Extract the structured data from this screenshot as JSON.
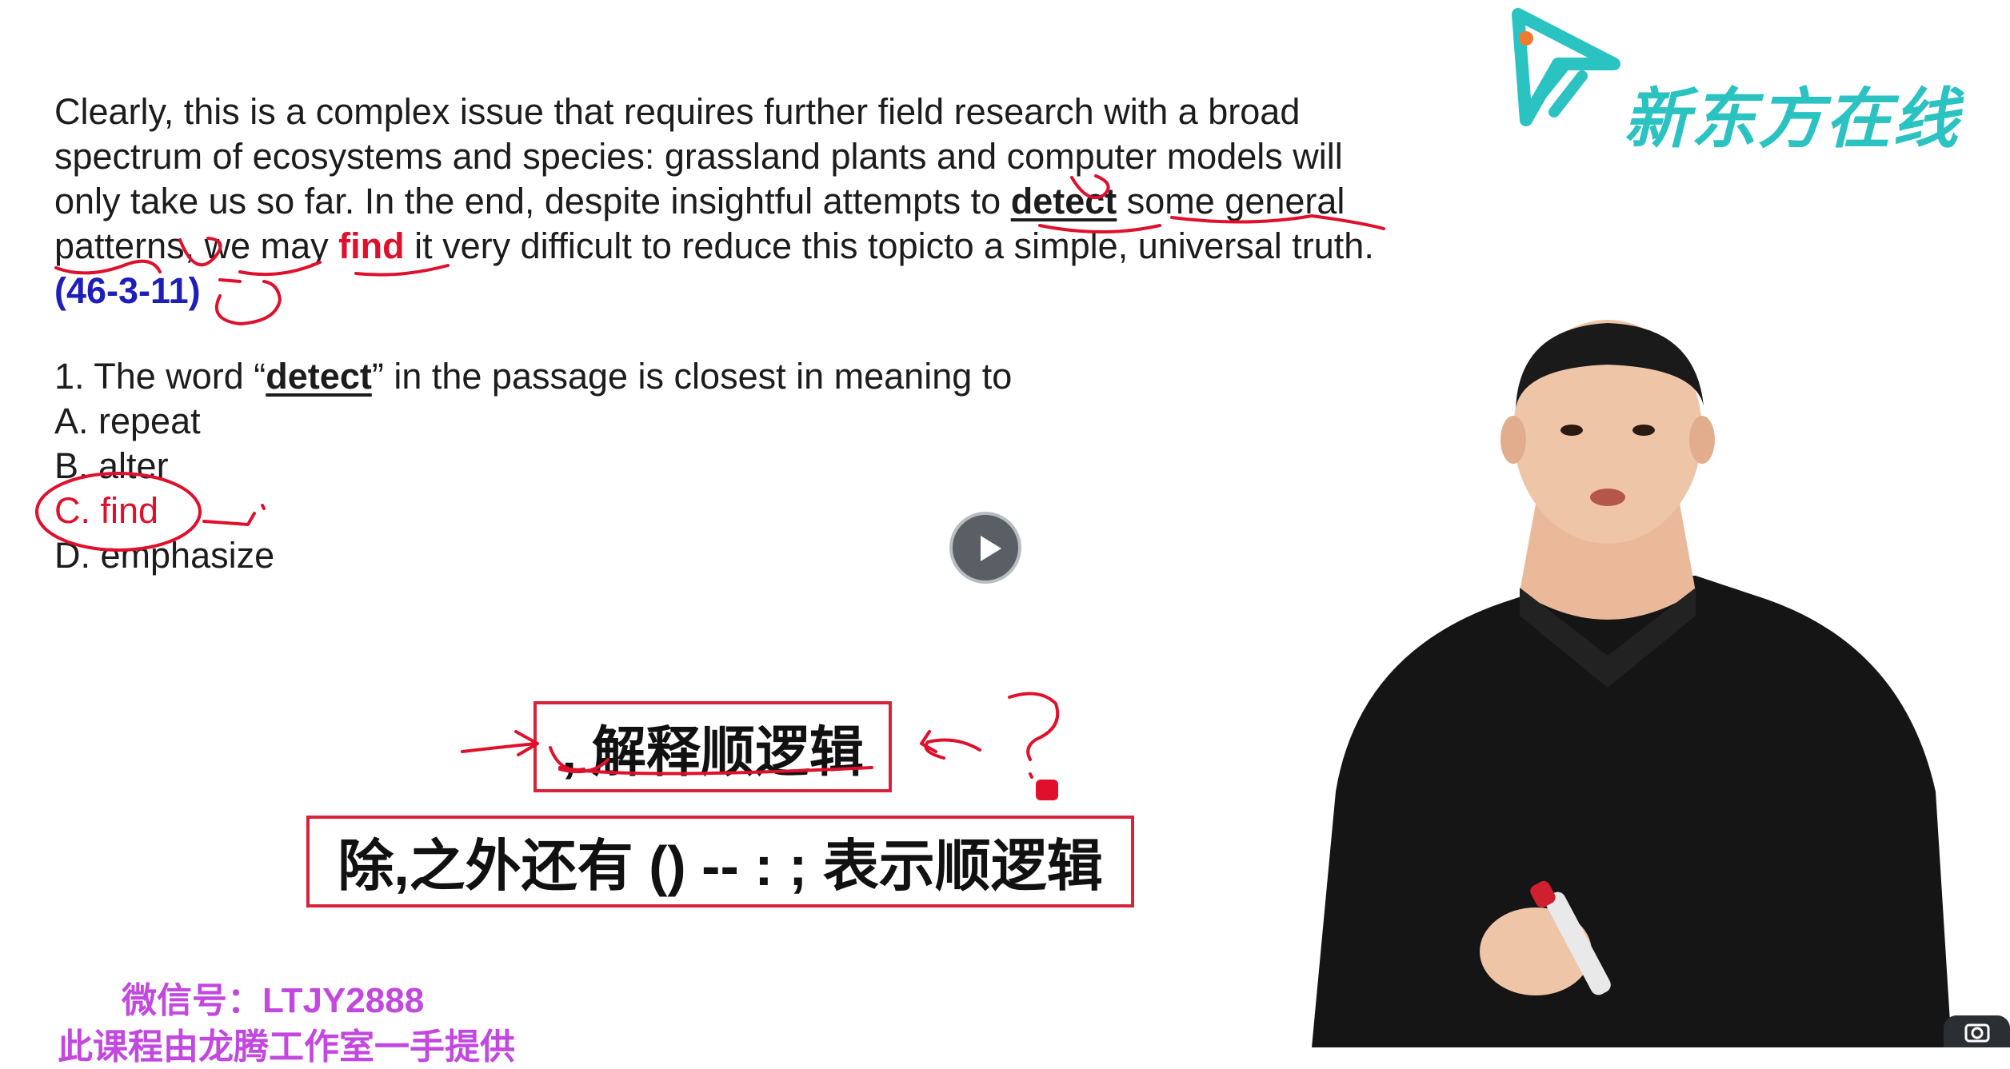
{
  "passage": {
    "line1": "Clearly, this is a complex issue that requires further field research with a broad",
    "line2": "spectrum of ecosystems and species: grassland plants and computer models will",
    "line3_a": "only take us so far. In the end, despite insightful attempts to ",
    "line3_word": "detect",
    "line3_b": " some general",
    "line4_a": "patterns, we may ",
    "line4_word": "find",
    "line4_b": " it very difficult to reduce this topicto a simple, universal truth.",
    "citation": "(46-3-11)"
  },
  "question": {
    "stem_a": "1. The word “",
    "stem_word": "detect",
    "stem_b": "” in the passage is closest in meaning to",
    "options": [
      "A. repeat",
      "B. alter",
      "C. find",
      "D. emphasize"
    ]
  },
  "rules": {
    "box1": ", 解释顺逻辑",
    "box2": "除,之外还有 () -- : ; 表示顺逻辑"
  },
  "watermark": {
    "line1": "微信号：LTJY2888",
    "line2": "此课程由龙腾工作室一手提供"
  },
  "logo": {
    "text": "新东方在线",
    "icon": "xdf-logo-icon"
  },
  "controls": {
    "play": "play-icon",
    "camera": "camera-icon"
  },
  "colors": {
    "accent_red": "#e0102c",
    "citation_blue": "#1e1eb8",
    "watermark": "#c248e0",
    "logo_teal": "#2bc2c2",
    "box_border": "#d8223a"
  }
}
